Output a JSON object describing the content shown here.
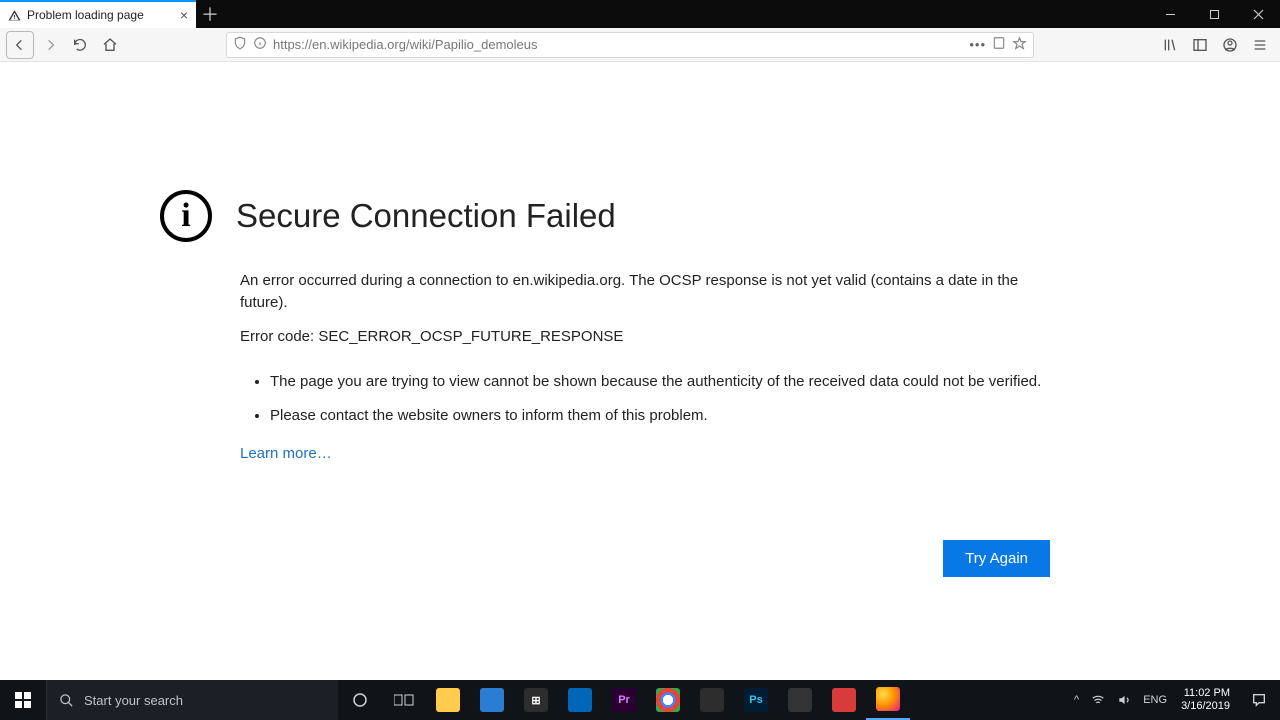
{
  "browser": {
    "tab_title": "Problem loading page",
    "url": "https://en.wikipedia.org/wiki/Papilio_demoleus"
  },
  "error": {
    "title": "Secure Connection Failed",
    "paragraph1": "An error occurred during a connection to en.wikipedia.org. The OCSP response is not yet valid (contains a date in the future).",
    "errorcode_line": "Error code: SEC_ERROR_OCSP_FUTURE_RESPONSE",
    "bullet1": "The page you are trying to view cannot be shown because the authenticity of the received data could not be verified.",
    "bullet2": "Please contact the website owners to inform them of this problem.",
    "learn_more": "Learn more…",
    "try_again": "Try Again"
  },
  "taskbar": {
    "search_placeholder": "Start your search",
    "lang": "ENG",
    "time": "11:02 PM",
    "date": "3/16/2019"
  }
}
